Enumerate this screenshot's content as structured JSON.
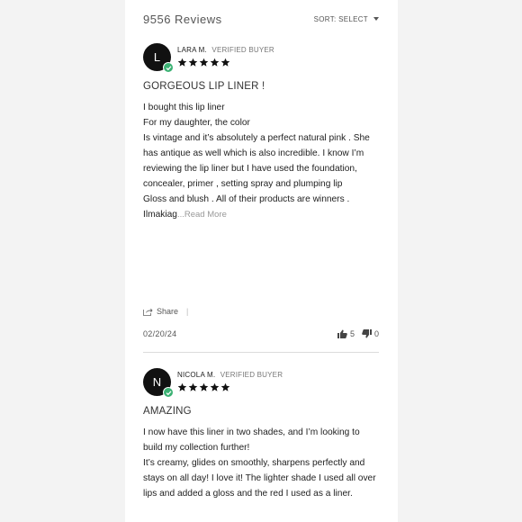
{
  "header": {
    "review_count": "9556 Reviews",
    "sort_label": "SORT: SELECT"
  },
  "reviews": [
    {
      "avatar_letter": "L",
      "author": "LARA M.",
      "verified_label": "VERIFIED BUYER",
      "rating": 5,
      "title": "GORGEOUS LIP LINER !",
      "lines": [
        "I bought this lip liner",
        "For my daughter, the color",
        "Is vintage and it’s absolutely a perfect natural pink . She has antique as well which is also incredible. I know I’m reviewing the lip liner but I have used the foundation, concealer, primer , setting spray and plumping lip",
        "Gloss and blush . All of their products are winners .",
        "Ilmakiag"
      ],
      "read_more": "...Read More",
      "share_label": "Share",
      "date": "02/20/24",
      "upvotes": "5",
      "downvotes": "0"
    },
    {
      "avatar_letter": "N",
      "author": "NICOLA M.",
      "verified_label": "VERIFIED BUYER",
      "rating": 5,
      "title": "AMAZING",
      "lines": [
        "I now have this liner in two shades, and I’m looking to build my collection further!",
        "It’s creamy, glides on smoothly, sharpens perfectly and stays on all day! I love it! The lighter shade I used all over lips and added a gloss and the red I used as a liner."
      ]
    }
  ],
  "colors": {
    "verified_badge": "#3bb173",
    "avatar_bg": "#111111",
    "star": "#111111"
  }
}
